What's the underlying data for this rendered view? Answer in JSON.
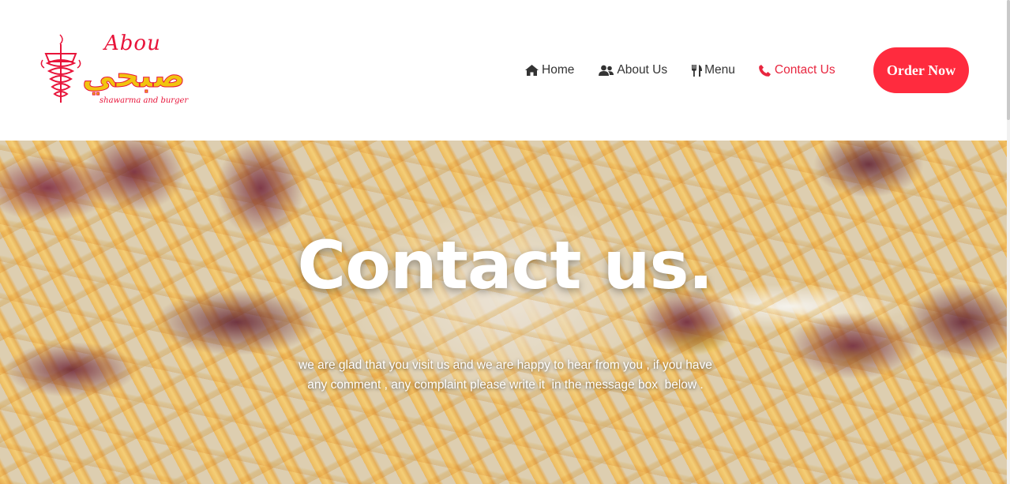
{
  "brand": {
    "name_en": "Abou",
    "name_ar": "صبحي",
    "tagline": "shawarma and burger",
    "color_primary": "#e8143a",
    "color_secondary": "#f1c40f"
  },
  "nav": {
    "items": [
      {
        "label": "Home",
        "icon": "home-icon",
        "active": false
      },
      {
        "label": "About Us",
        "icon": "users-icon",
        "active": false
      },
      {
        "label": "Menu",
        "icon": "cutlery-icon",
        "active": false
      },
      {
        "label": "Contact Us",
        "icon": "phone-icon",
        "active": true
      }
    ],
    "text_color": "#333333",
    "active_color": "#e8263f"
  },
  "order_button": {
    "label": "Order Now",
    "color": "#ff2b3e"
  },
  "hero": {
    "title": "Contact us.",
    "text_line_1": "we are glad that you visit us and we are happy to hear from you , if you have",
    "text_line_2": "any comment , any complaint please write it  in the message box  below ."
  }
}
